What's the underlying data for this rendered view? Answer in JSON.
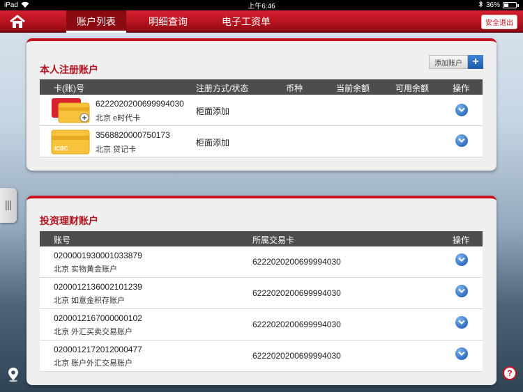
{
  "status_bar": {
    "device": "iPad",
    "time": "上午6:46",
    "battery": "36%"
  },
  "nav": {
    "home_icon": "home-icon",
    "tabs": [
      {
        "label": "账户列表",
        "active": true
      },
      {
        "label": "明细查询",
        "active": false
      },
      {
        "label": "电子工资单",
        "active": false
      }
    ],
    "logout_label": "安全退出"
  },
  "personal": {
    "title": "本人注册账户",
    "add_label": "添加账户",
    "add_plus": "+",
    "headers": [
      "卡(账)号",
      "注册方式/状态",
      "币种",
      "当前余额",
      "可用余额",
      "操作"
    ],
    "rows": [
      {
        "card_no": "6222020200699994030",
        "card_desc": "北京 e时代卡",
        "reg": "柜面添加",
        "card_type": "multi-card"
      },
      {
        "card_no": "3568820000750173",
        "card_desc": "北京 贷记卡",
        "reg": "柜面添加",
        "card_type": "icbc-card",
        "card_brand": "ICBC"
      }
    ]
  },
  "invest": {
    "title": "投资理财账户",
    "headers": [
      "账号",
      "所属交易卡",
      "操作"
    ],
    "rows": [
      {
        "account": "0200001930001033879",
        "desc": "北京 实物黄金账户",
        "card": "6222020200699994030"
      },
      {
        "account": "0200012136002101239",
        "desc": "北京 如意金积存账户",
        "card": "6222020200699994030"
      },
      {
        "account": "0200012167000000102",
        "desc": "北京 外汇买卖交易账户",
        "card": "6222020200699994030"
      },
      {
        "account": "0200012172012000477",
        "desc": "北京 账户外汇交易账户",
        "card": "6222020200699994030"
      }
    ]
  },
  "footer": {
    "help_label": "?"
  },
  "colors": {
    "brand_red": "#c8101e",
    "header_gray": "#4d4d4d",
    "action_blue": "#2f6fc2"
  }
}
